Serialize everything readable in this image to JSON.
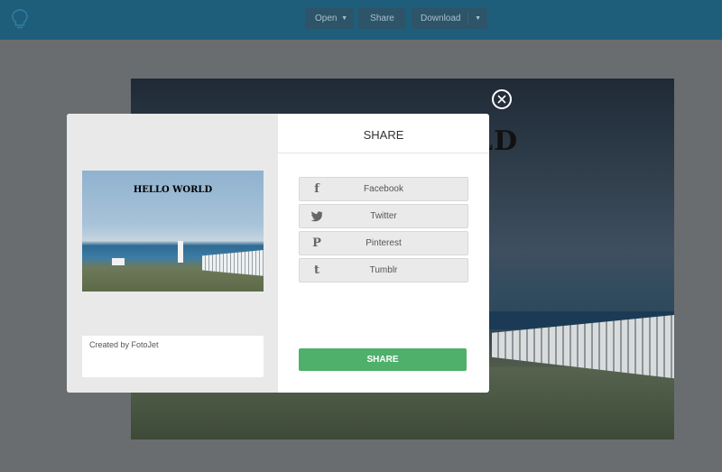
{
  "toolbar": {
    "open_label": "Open",
    "share_label": "Share",
    "download_label": "Download",
    "open_icon": "caret-down-icon",
    "download_icon": "caret-down-icon",
    "app_icon": "lightbulb-icon"
  },
  "canvas": {
    "title_fragment": "LD"
  },
  "modal": {
    "title": "SHARE",
    "preview_title": "HELLO WORLD",
    "caption_text": "Created by FotoJet",
    "share_buttons": [
      {
        "label": "Facebook",
        "icon": "facebook-icon",
        "glyph": "f"
      },
      {
        "label": "Twitter",
        "icon": "twitter-icon",
        "glyph": ""
      },
      {
        "label": "Pinterest",
        "icon": "pinterest-icon",
        "glyph": "P"
      },
      {
        "label": "Tumblr",
        "icon": "tumblr-icon",
        "glyph": "t"
      }
    ],
    "submit_label": "SHARE",
    "close_icon": "close-icon"
  },
  "colors": {
    "topbar": "#1f5e7b",
    "accent_green": "#4fb06b",
    "overlay": "#6a6d70"
  }
}
